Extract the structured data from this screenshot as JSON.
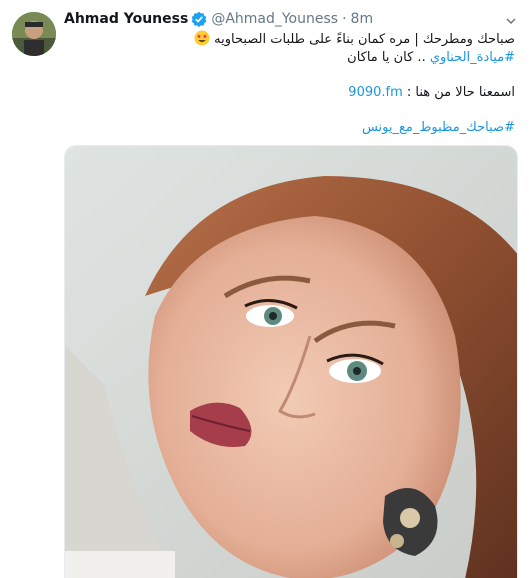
{
  "author": {
    "name": "Ahmad Youness",
    "handle": "@Ahmad_Youness",
    "separator": "·",
    "time": "8m"
  },
  "tweet": {
    "line1_text": "صباحك ومطرحك | مره كمان بناءً على طلبات الصبحاويه",
    "line1_emoji": "star-struck-emoji",
    "line2_hashtag": "#ميادة_الحناوي",
    "line2_text": " .. كان يا ماكان",
    "line3_text": "اسمعنا حالا من هنا : ",
    "line3_link": "9090.fm",
    "line4_hashtag": "#صباحك_مظبوط_مع_يونس"
  },
  "colors": {
    "link": "#1b95e0",
    "secondary_text": "#657786",
    "verified": "#1da1f2"
  },
  "media": {
    "icon": "portrait-photo"
  }
}
